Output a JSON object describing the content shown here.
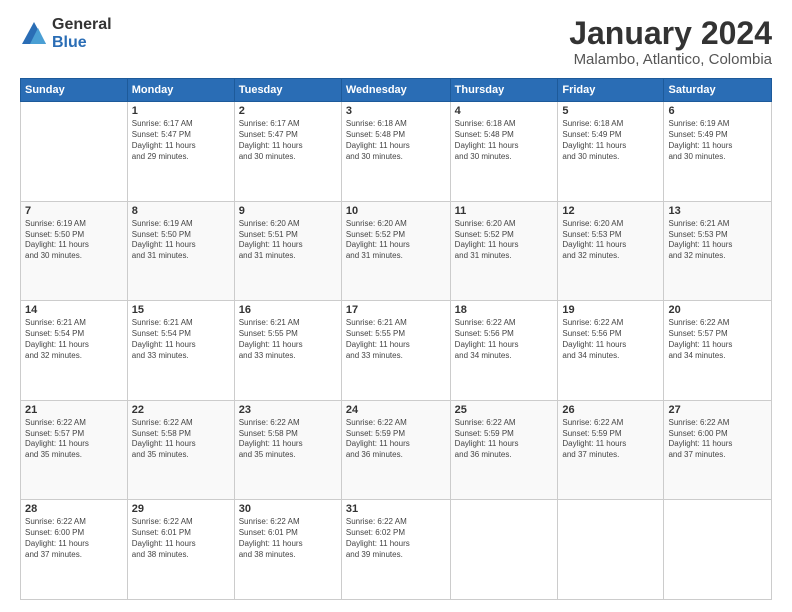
{
  "logo": {
    "general": "General",
    "blue": "Blue"
  },
  "title": "January 2024",
  "subtitle": "Malambo, Atlantico, Colombia",
  "weekdays": [
    "Sunday",
    "Monday",
    "Tuesday",
    "Wednesday",
    "Thursday",
    "Friday",
    "Saturday"
  ],
  "weeks": [
    [
      {
        "num": "",
        "info": ""
      },
      {
        "num": "1",
        "info": "Sunrise: 6:17 AM\nSunset: 5:47 PM\nDaylight: 11 hours\nand 29 minutes."
      },
      {
        "num": "2",
        "info": "Sunrise: 6:17 AM\nSunset: 5:47 PM\nDaylight: 11 hours\nand 30 minutes."
      },
      {
        "num": "3",
        "info": "Sunrise: 6:18 AM\nSunset: 5:48 PM\nDaylight: 11 hours\nand 30 minutes."
      },
      {
        "num": "4",
        "info": "Sunrise: 6:18 AM\nSunset: 5:48 PM\nDaylight: 11 hours\nand 30 minutes."
      },
      {
        "num": "5",
        "info": "Sunrise: 6:18 AM\nSunset: 5:49 PM\nDaylight: 11 hours\nand 30 minutes."
      },
      {
        "num": "6",
        "info": "Sunrise: 6:19 AM\nSunset: 5:49 PM\nDaylight: 11 hours\nand 30 minutes."
      }
    ],
    [
      {
        "num": "7",
        "info": "Sunrise: 6:19 AM\nSunset: 5:50 PM\nDaylight: 11 hours\nand 30 minutes."
      },
      {
        "num": "8",
        "info": "Sunrise: 6:19 AM\nSunset: 5:50 PM\nDaylight: 11 hours\nand 31 minutes."
      },
      {
        "num": "9",
        "info": "Sunrise: 6:20 AM\nSunset: 5:51 PM\nDaylight: 11 hours\nand 31 minutes."
      },
      {
        "num": "10",
        "info": "Sunrise: 6:20 AM\nSunset: 5:52 PM\nDaylight: 11 hours\nand 31 minutes."
      },
      {
        "num": "11",
        "info": "Sunrise: 6:20 AM\nSunset: 5:52 PM\nDaylight: 11 hours\nand 31 minutes."
      },
      {
        "num": "12",
        "info": "Sunrise: 6:20 AM\nSunset: 5:53 PM\nDaylight: 11 hours\nand 32 minutes."
      },
      {
        "num": "13",
        "info": "Sunrise: 6:21 AM\nSunset: 5:53 PM\nDaylight: 11 hours\nand 32 minutes."
      }
    ],
    [
      {
        "num": "14",
        "info": "Sunrise: 6:21 AM\nSunset: 5:54 PM\nDaylight: 11 hours\nand 32 minutes."
      },
      {
        "num": "15",
        "info": "Sunrise: 6:21 AM\nSunset: 5:54 PM\nDaylight: 11 hours\nand 33 minutes."
      },
      {
        "num": "16",
        "info": "Sunrise: 6:21 AM\nSunset: 5:55 PM\nDaylight: 11 hours\nand 33 minutes."
      },
      {
        "num": "17",
        "info": "Sunrise: 6:21 AM\nSunset: 5:55 PM\nDaylight: 11 hours\nand 33 minutes."
      },
      {
        "num": "18",
        "info": "Sunrise: 6:22 AM\nSunset: 5:56 PM\nDaylight: 11 hours\nand 34 minutes."
      },
      {
        "num": "19",
        "info": "Sunrise: 6:22 AM\nSunset: 5:56 PM\nDaylight: 11 hours\nand 34 minutes."
      },
      {
        "num": "20",
        "info": "Sunrise: 6:22 AM\nSunset: 5:57 PM\nDaylight: 11 hours\nand 34 minutes."
      }
    ],
    [
      {
        "num": "21",
        "info": "Sunrise: 6:22 AM\nSunset: 5:57 PM\nDaylight: 11 hours\nand 35 minutes."
      },
      {
        "num": "22",
        "info": "Sunrise: 6:22 AM\nSunset: 5:58 PM\nDaylight: 11 hours\nand 35 minutes."
      },
      {
        "num": "23",
        "info": "Sunrise: 6:22 AM\nSunset: 5:58 PM\nDaylight: 11 hours\nand 35 minutes."
      },
      {
        "num": "24",
        "info": "Sunrise: 6:22 AM\nSunset: 5:59 PM\nDaylight: 11 hours\nand 36 minutes."
      },
      {
        "num": "25",
        "info": "Sunrise: 6:22 AM\nSunset: 5:59 PM\nDaylight: 11 hours\nand 36 minutes."
      },
      {
        "num": "26",
        "info": "Sunrise: 6:22 AM\nSunset: 5:59 PM\nDaylight: 11 hours\nand 37 minutes."
      },
      {
        "num": "27",
        "info": "Sunrise: 6:22 AM\nSunset: 6:00 PM\nDaylight: 11 hours\nand 37 minutes."
      }
    ],
    [
      {
        "num": "28",
        "info": "Sunrise: 6:22 AM\nSunset: 6:00 PM\nDaylight: 11 hours\nand 37 minutes."
      },
      {
        "num": "29",
        "info": "Sunrise: 6:22 AM\nSunset: 6:01 PM\nDaylight: 11 hours\nand 38 minutes."
      },
      {
        "num": "30",
        "info": "Sunrise: 6:22 AM\nSunset: 6:01 PM\nDaylight: 11 hours\nand 38 minutes."
      },
      {
        "num": "31",
        "info": "Sunrise: 6:22 AM\nSunset: 6:02 PM\nDaylight: 11 hours\nand 39 minutes."
      },
      {
        "num": "",
        "info": ""
      },
      {
        "num": "",
        "info": ""
      },
      {
        "num": "",
        "info": ""
      }
    ]
  ]
}
